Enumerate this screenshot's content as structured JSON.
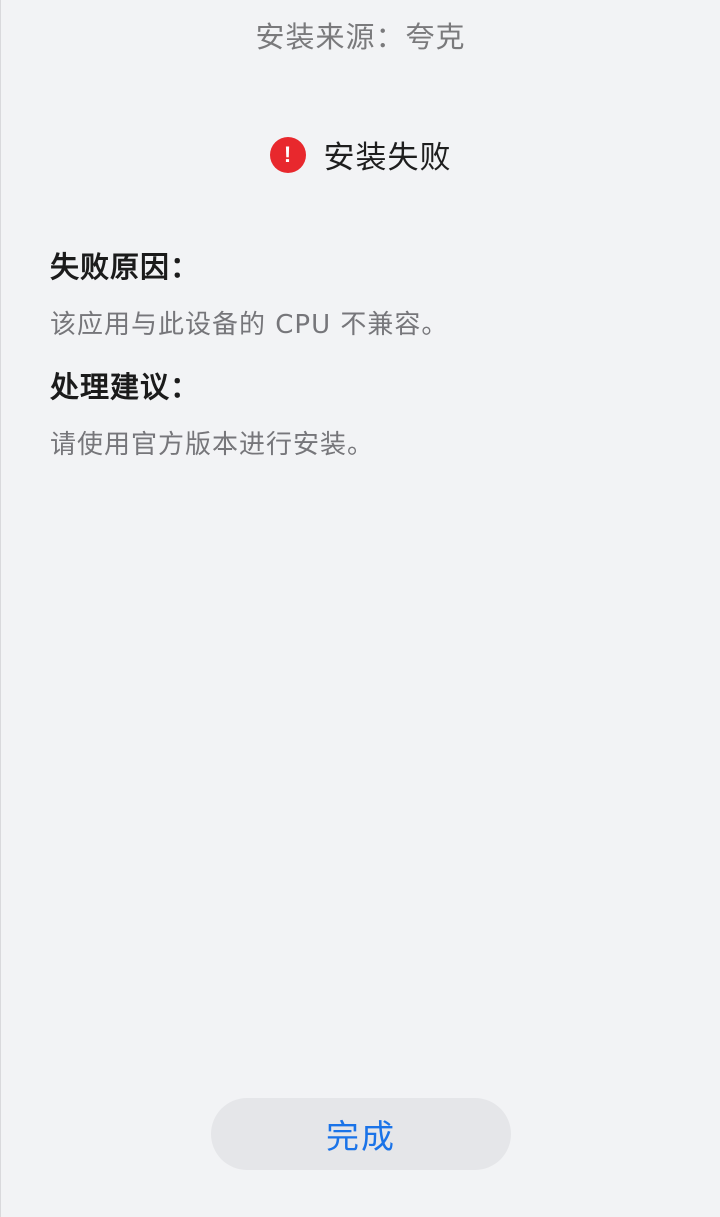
{
  "header": {
    "source_text": "安装来源：夸克"
  },
  "status": {
    "icon": "exclamation-circle-icon",
    "icon_glyph": "!",
    "icon_color": "#e8282d",
    "text": "安装失败"
  },
  "reason": {
    "title": "失败原因：",
    "body": "该应用与此设备的 CPU 不兼容。"
  },
  "advice": {
    "title": "处理建议：",
    "body": "请使用官方版本进行安装。"
  },
  "actions": {
    "done_label": "完成",
    "done_color": "#1a73e8"
  }
}
